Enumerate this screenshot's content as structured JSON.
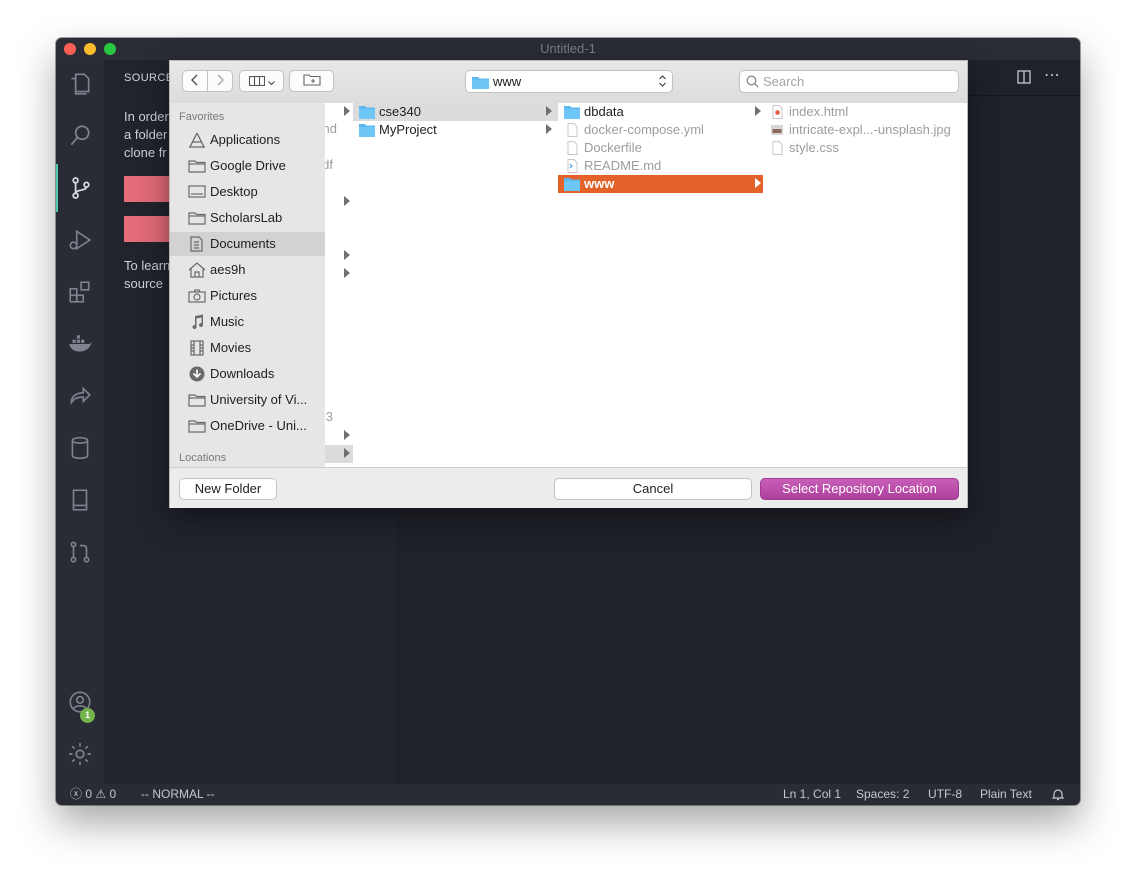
{
  "window": {
    "title": "Untitled-1"
  },
  "sidebar": {
    "title": "SOURCE",
    "text_lines": [
      "In order",
      "a folder",
      "clone fr",
      "To learn",
      "source"
    ]
  },
  "status": {
    "errors": "0",
    "warnings": "0",
    "mode": "-- NORMAL --",
    "position": "Ln 1, Col 1",
    "spaces": "Spaces: 2",
    "encoding": "UTF-8",
    "language": "Plain Text"
  },
  "activity_badge": "1",
  "dialog": {
    "path": "www",
    "search_placeholder": "Search",
    "favorites_header": "Favorites",
    "locations_header": "Locations",
    "favorites": [
      {
        "label": "Applications",
        "icon": "applications-icon"
      },
      {
        "label": "Google Drive",
        "icon": "folder-icon"
      },
      {
        "label": "Desktop",
        "icon": "desktop-icon"
      },
      {
        "label": "ScholarsLab",
        "icon": "folder-icon"
      },
      {
        "label": "Documents",
        "icon": "documents-icon",
        "selected": true
      },
      {
        "label": "aes9h",
        "icon": "home-icon"
      },
      {
        "label": "Pictures",
        "icon": "camera-icon"
      },
      {
        "label": "Music",
        "icon": "music-icon"
      },
      {
        "label": "Movies",
        "icon": "film-icon"
      },
      {
        "label": "Downloads",
        "icon": "download-icon"
      },
      {
        "label": "University of Vi...",
        "icon": "folder-icon"
      },
      {
        "label": "OneDrive - Uni...",
        "icon": "folder-icon"
      }
    ],
    "partial_column_fragments": [
      "nd",
      "df",
      "3"
    ],
    "column1": [
      {
        "label": "cse340",
        "selected": true
      },
      {
        "label": "MyProject"
      }
    ],
    "column2": [
      {
        "label": "dbdata",
        "type": "folder"
      },
      {
        "label": "docker-compose.yml",
        "type": "file"
      },
      {
        "label": "Dockerfile",
        "type": "file"
      },
      {
        "label": "README.md",
        "type": "markdown"
      },
      {
        "label": "www",
        "type": "folder",
        "selected": true
      }
    ],
    "column3": [
      {
        "label": "index.html",
        "type": "html"
      },
      {
        "label": "intricate-expl...-unsplash.jpg",
        "type": "image"
      },
      {
        "label": "style.css",
        "type": "file"
      }
    ],
    "buttons": {
      "new_folder": "New Folder",
      "cancel": "Cancel",
      "select": "Select Repository Location"
    },
    "colors": {
      "selection": "#e2622a",
      "primary_button": "#b94aa9"
    }
  }
}
